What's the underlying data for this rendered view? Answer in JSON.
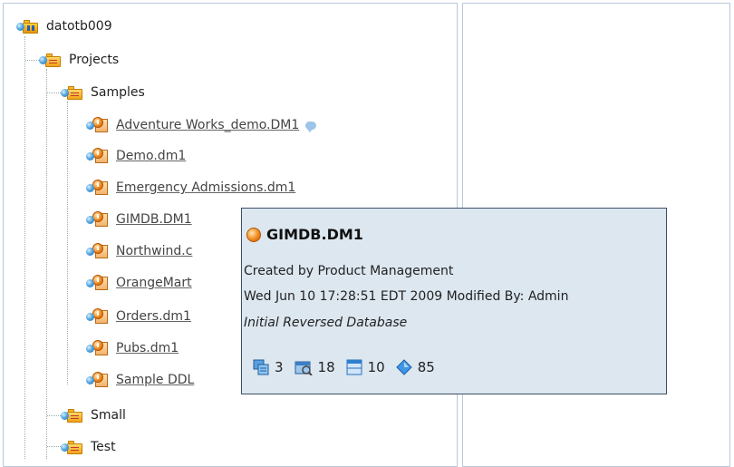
{
  "tree": {
    "root": {
      "label": "datotb009"
    },
    "projects": {
      "label": "Projects"
    },
    "samples": {
      "label": "Samples"
    },
    "models": [
      {
        "label": "Adventure Works_demo.DM1",
        "has_comment": true
      },
      {
        "label": "Demo.dm1"
      },
      {
        "label": "Emergency Admissions.dm1"
      },
      {
        "label": "GIMDB.DM1"
      },
      {
        "label": "Northwind.c"
      },
      {
        "label": "OrangeMart"
      },
      {
        "label": "Orders.dm1"
      },
      {
        "label": "Pubs.dm1"
      },
      {
        "label": "Sample DDL"
      }
    ],
    "small": {
      "label": "Small"
    },
    "test": {
      "label": "Test"
    }
  },
  "tooltip": {
    "title": "GIMDB.DM1",
    "created": "Created by Product Management",
    "modified": "Wed Jun 10 17:28:51 EDT 2009 Modified By: Admin",
    "description": "Initial Reversed Database",
    "stats": {
      "submodels": "3",
      "entities": "18",
      "tables": "10",
      "attributes": "85"
    }
  },
  "colors": {
    "tooltip_bg": "#dde7f0",
    "tooltip_border": "#3c4f66",
    "pane_border": "#b9c9dc"
  }
}
